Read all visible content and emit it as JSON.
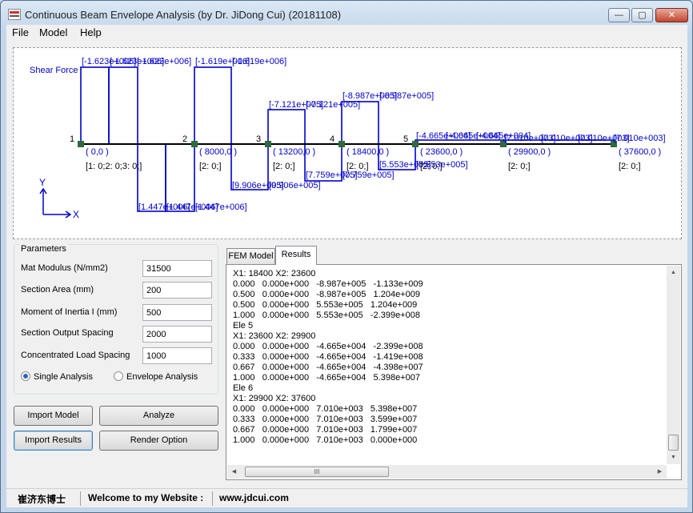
{
  "window": {
    "title": "Continuous Beam Envelope Analysis (by Dr. JiDong Cui) (20181108)",
    "controls": {
      "minimize": "—",
      "maximize": "▢",
      "close": "✕"
    }
  },
  "menu": [
    "File",
    "Model",
    "Help"
  ],
  "diagram": {
    "label": "Shear Force",
    "axis_y": "Y",
    "axis_x": "X",
    "nodes": [
      {
        "num": "1",
        "coord": "( 0,0 )",
        "support": "[1: 0;2: 0;3: 0;]"
      },
      {
        "num": "2",
        "coord": "( 8000,0 )",
        "support": "[2: 0;]"
      },
      {
        "num": "3",
        "coord": "( 13200,0 )",
        "support": "[2: 0;]"
      },
      {
        "num": "4",
        "coord": "( 18400,0 )",
        "support": "[2: 0;]"
      },
      {
        "num": "5",
        "coord": "( 23600,0 )",
        "support": "[2: 0;]"
      },
      {
        "num": "",
        "coord": "( 29900,0 )",
        "support": "[2: 0;]"
      },
      {
        "num": "",
        "coord": "( 37600,0 )",
        "support": "[2: 0;]"
      }
    ],
    "value_labels": [
      "[-1.623e+006]",
      "[-1.623e+006]",
      "[-1.623e+006]",
      "[-1.619e+006]",
      "[-1.619e+006]",
      "[-7.121e+005]",
      "[-7.121e+005]",
      "[-8.987e+005]",
      "[-8.987e+005]",
      "[-4.665e+004]",
      "[-4.665e+004]",
      "[-4.665e+004]",
      "[7.010e+003]",
      "[7.010e+003]",
      "[7.010e+003]",
      "[7.010e+003]",
      "[1.447e+006]",
      "[1.447e+006]",
      "[1.447e+006]",
      "[9.906e+005]",
      "[9.906e+005]",
      "[7.759e+005]",
      "[7.759e+005]",
      "[5.553e+005]",
      "[5.553e+005]"
    ],
    "colors": {
      "diagram": "#0000cc",
      "beam": "#000000",
      "node": "#2e6b3e"
    }
  },
  "parameters": {
    "title": "Parameters",
    "fields": [
      {
        "label": "Mat Modulus (N/mm2)",
        "value": "31500"
      },
      {
        "label": "Section Area  (mm)",
        "value": "200"
      },
      {
        "label": "Moment of Inertia I (mm)",
        "value": "500"
      },
      {
        "label": "Section Output Spacing",
        "value": "2000"
      },
      {
        "label": "Concentrated Load Spacing",
        "value": "1000"
      }
    ],
    "radios": [
      {
        "label": "Single Analysis",
        "selected": true
      },
      {
        "label": "Envelope Analysis",
        "selected": false
      }
    ]
  },
  "buttons": {
    "import_model": "Import Model",
    "analyze": "Analyze",
    "import_results": "Import Results",
    "render_option": "Render Option"
  },
  "tabs": {
    "fem_model": "FEM Model",
    "results": "Results"
  },
  "results_lines": [
    "X1: 18400 X2: 23600",
    "0.000   0.000e+000   -8.987e+005   -1.133e+009",
    "0.500   0.000e+000   -8.987e+005   1.204e+009",
    "0.500   0.000e+000   5.553e+005   1.204e+009",
    "1.000   0.000e+000   5.553e+005   -2.399e+008",
    "Ele 5",
    "X1: 23600 X2: 29900",
    "0.000   0.000e+000   -4.665e+004   -2.399e+008",
    "0.333   0.000e+000   -4.665e+004   -1.419e+008",
    "0.667   0.000e+000   -4.665e+004   -4.398e+007",
    "1.000   0.000e+000   -4.665e+004   5.398e+007",
    "Ele 6",
    "X1: 29900 X2: 37600",
    "0.000   0.000e+000   7.010e+003   5.398e+007",
    "0.333   0.000e+000   7.010e+003   3.599e+007",
    "0.667   0.000e+000   7.010e+003   1.799e+007",
    "1.000   0.000e+000   7.010e+003   0.000e+000"
  ],
  "scroll": {
    "up": "▲",
    "down": "▼",
    "left": "◀",
    "right": "▶",
    "grip": "III"
  },
  "status": {
    "name": "崔济东博士",
    "welcome": "Welcome to my Website :",
    "website": "www.jdcui.com"
  }
}
